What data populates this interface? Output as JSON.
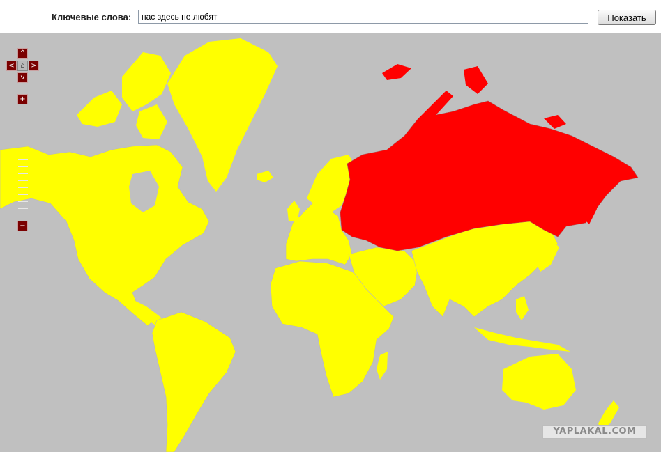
{
  "search": {
    "label": "Ключевые слова:",
    "value": "нас здесь не любят",
    "button_label": "Показать"
  },
  "map_controls": {
    "pan_up": "^",
    "pan_left": "<",
    "pan_right": ">",
    "pan_down": "v",
    "home_icon": "⌂",
    "zoom_in": "+",
    "zoom_out": "−"
  },
  "watermark": {
    "text": "YAPLAKAL.COM"
  },
  "colors": {
    "ocean": "#c0c0c0",
    "land": "#ffff00",
    "highlighted": "#ff0000",
    "control": "#7a0000"
  },
  "highlighted_region": "Russia and former Soviet states"
}
